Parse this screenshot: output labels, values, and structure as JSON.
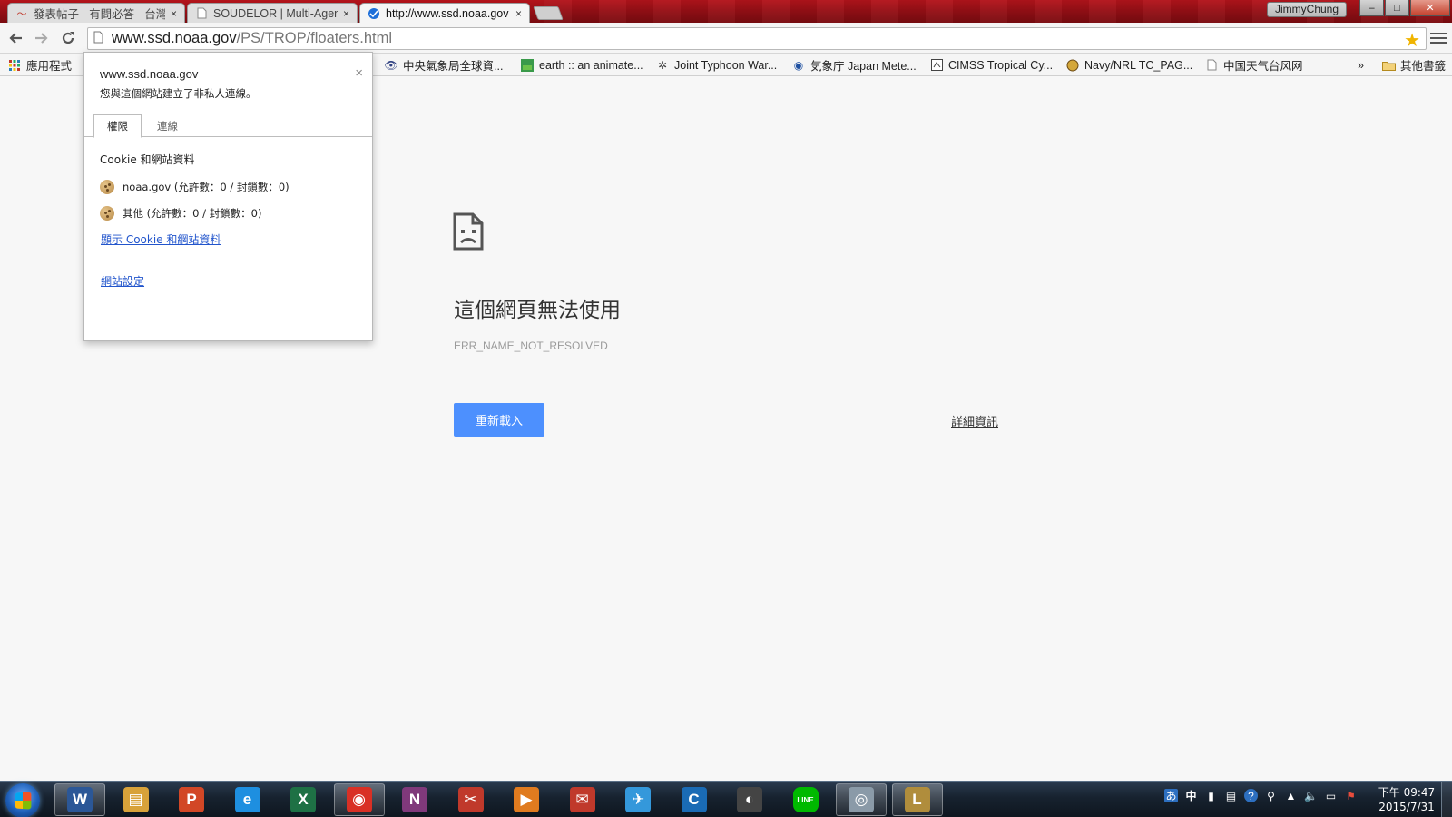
{
  "window": {
    "tabs": [
      {
        "title": "發表帖子 - 有問必答 - 台灣...",
        "favicon": "swirl-favicon-icon",
        "close": "×"
      },
      {
        "title": "SOUDELOR | Multi-Agency",
        "favicon": "page-favicon-icon",
        "close": "×"
      },
      {
        "title": "http://www.ssd.noaa.gov",
        "favicon": "globe-favicon-icon",
        "close": "×"
      }
    ],
    "user": "JimmyChung",
    "controls": {
      "minimize": "–",
      "maximize": "□",
      "close": "✕"
    }
  },
  "toolbar": {
    "url_host": "www.ssd.noaa.gov",
    "url_path": "/PS/TROP/floaters.html"
  },
  "bookmarks": {
    "apps_label": "應用程式",
    "items": [
      "中央氣象局全球資...",
      "earth :: an animate...",
      "Joint Typhoon War...",
      "気象庁 Japan Mete...",
      "CIMSS Tropical Cy...",
      "Navy/NRL TC_PAG...",
      "中国天气台风网"
    ],
    "overflow": "»",
    "other_label": "其他書籤"
  },
  "popup": {
    "host": "www.ssd.noaa.gov",
    "subtitle": "您與這個網站建立了非私人連線。",
    "close": "×",
    "tab_permissions": "權限",
    "tab_connection": "連線",
    "section_title": "Cookie 和網站資料",
    "cookies": [
      "noaa.gov (允許數：0 / 封鎖數：0)",
      "其他 (允許數：0 / 封鎖數：0)"
    ],
    "show_cookies_link": "顯示 Cookie 和網站資料",
    "site_settings_link": "網站設定"
  },
  "error_page": {
    "title": "這個網頁無法使用",
    "code": "ERR_NAME_NOT_RESOLVED",
    "reload_label": "重新載入",
    "details_label": "詳細資訊"
  },
  "taskbar": {
    "apps": [
      {
        "name": "word",
        "glyph": "W",
        "color": "#2b5797"
      },
      {
        "name": "explorer",
        "glyph": "▤",
        "color": "#d8a23a"
      },
      {
        "name": "powerpoint",
        "glyph": "P",
        "color": "#d24726"
      },
      {
        "name": "internet-explorer",
        "glyph": "e",
        "color": "#1e8fe0"
      },
      {
        "name": "excel",
        "glyph": "X",
        "color": "#1e7145"
      },
      {
        "name": "chrome",
        "glyph": "◉",
        "color": "#d93025"
      },
      {
        "name": "onenote",
        "glyph": "N",
        "color": "#80397b"
      },
      {
        "name": "snipping-tool",
        "glyph": "✂",
        "color": "#c0392b"
      },
      {
        "name": "media-player",
        "glyph": "▶",
        "color": "#e07b1f"
      },
      {
        "name": "app-red",
        "glyph": "✉",
        "color": "#c0392b"
      },
      {
        "name": "messenger",
        "glyph": "✈",
        "color": "#3498db"
      },
      {
        "name": "ccleaner",
        "glyph": "C",
        "color": "#1a6bb5"
      },
      {
        "name": "app-ring",
        "glyph": "◐",
        "color": "#444444"
      },
      {
        "name": "line",
        "glyph": "LINE",
        "color": "#00b900"
      },
      {
        "name": "app-disc",
        "glyph": "◎",
        "color": "#8a9aa8"
      },
      {
        "name": "league-of-legends",
        "glyph": "L",
        "color": "#b08d3c"
      }
    ],
    "clock_period_time": "下午 09:47",
    "clock_date": "2015/7/31",
    "ime": "中"
  }
}
